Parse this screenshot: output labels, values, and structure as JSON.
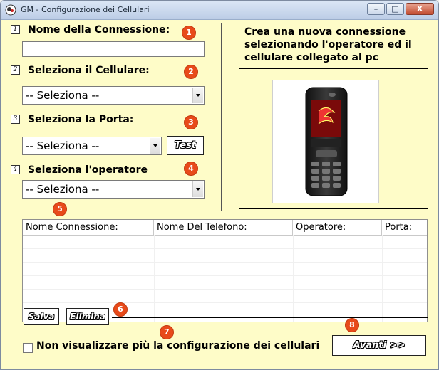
{
  "window": {
    "title": "GM - Configurazione dei Cellulari",
    "controls": {
      "minimize": "–",
      "maximize": "□",
      "close": "X"
    }
  },
  "form": {
    "step1": {
      "num": "1",
      "label": "Nome della Connessione:",
      "value": ""
    },
    "step2": {
      "num": "2",
      "label": "Seleziona il Cellulare:",
      "selected": "-- Seleziona --"
    },
    "step3": {
      "num": "3",
      "label": "Seleziona la Porta:",
      "selected": "-- Seleziona --",
      "test_label": "Test"
    },
    "step4": {
      "num": "4",
      "label": "Seleziona l'operatore",
      "selected": "-- Seleziona --"
    }
  },
  "description": "Crea una nuova connessione selezionando l'operatore ed il cellulare collegato al pc",
  "table": {
    "columns": [
      "Nome Connessione:",
      "Nome Del Telefono:",
      "Operatore:",
      "Porta:"
    ],
    "rows": []
  },
  "actions": {
    "save_label": "Salva",
    "delete_label": "Elimina",
    "next_label": "Avanti >>"
  },
  "checkbox": {
    "label": "Non visualizzare più la configurazione dei cellulari",
    "checked": false
  },
  "callouts": [
    "1",
    "2",
    "3",
    "4",
    "5",
    "6",
    "7",
    "8"
  ],
  "colors": {
    "background": "#fefcc8",
    "callout": "#e84a1a"
  }
}
